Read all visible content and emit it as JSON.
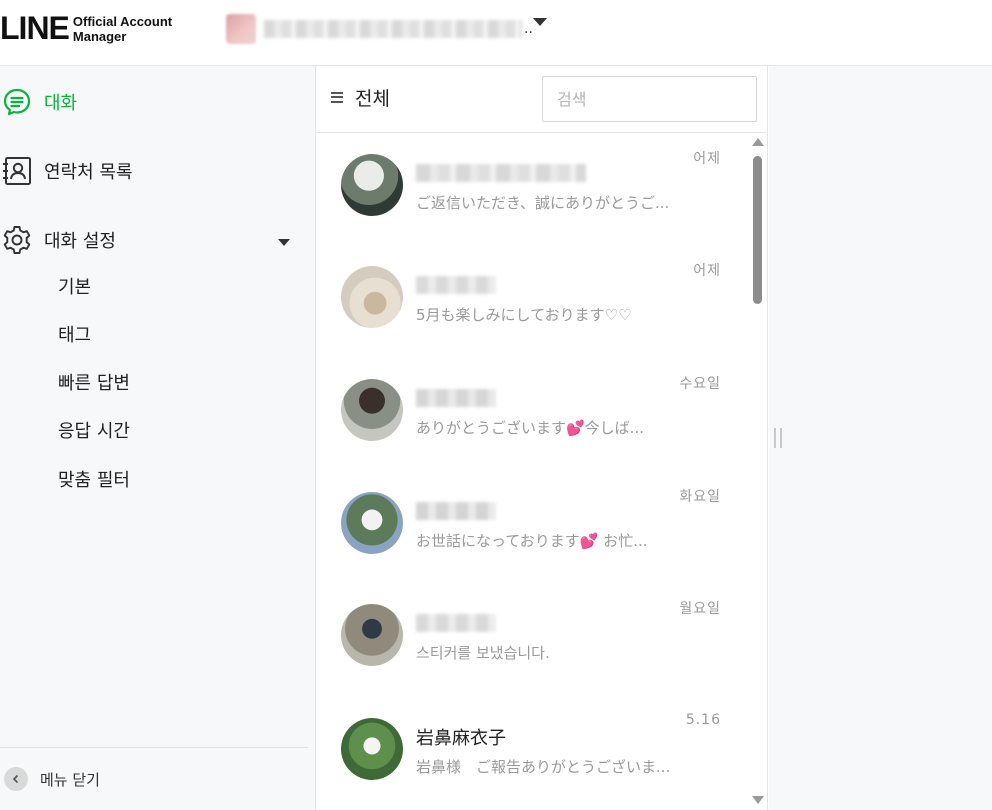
{
  "header": {
    "logo_main": "LINE",
    "logo_sub_line1": "Official Account",
    "logo_sub_line2": "Manager",
    "account_ellipsis": ".."
  },
  "sidebar": {
    "chat": "대화",
    "contacts": "연락처 목록",
    "chat_settings": "대화 설정",
    "sub_items": [
      "기본",
      "태그",
      "빠른 답변",
      "응답 시간",
      "맞춤 필터"
    ],
    "close_menu": "메뉴 닫기",
    "accent_color": "#07b53b"
  },
  "chat_list": {
    "filter_label": "전체",
    "search_placeholder": "검색",
    "items": [
      {
        "name": "",
        "preview": "ご返信いただき、誠にありがとうご...",
        "time": "어제"
      },
      {
        "name": "",
        "preview": "5月も楽しみにしております♡♡",
        "time": "어제"
      },
      {
        "name": "",
        "preview": "ありがとうございます💕今しば...",
        "time": "수요일"
      },
      {
        "name": "",
        "preview": "お世話になっております💕 お忙...",
        "time": "화요일"
      },
      {
        "name": "",
        "preview": "스티커를 보냈습니다.",
        "time": "월요일"
      },
      {
        "name": "岩鼻麻衣子",
        "preview": "岩鼻様　ご報告ありがとうございま...",
        "time": "5.16"
      }
    ]
  }
}
